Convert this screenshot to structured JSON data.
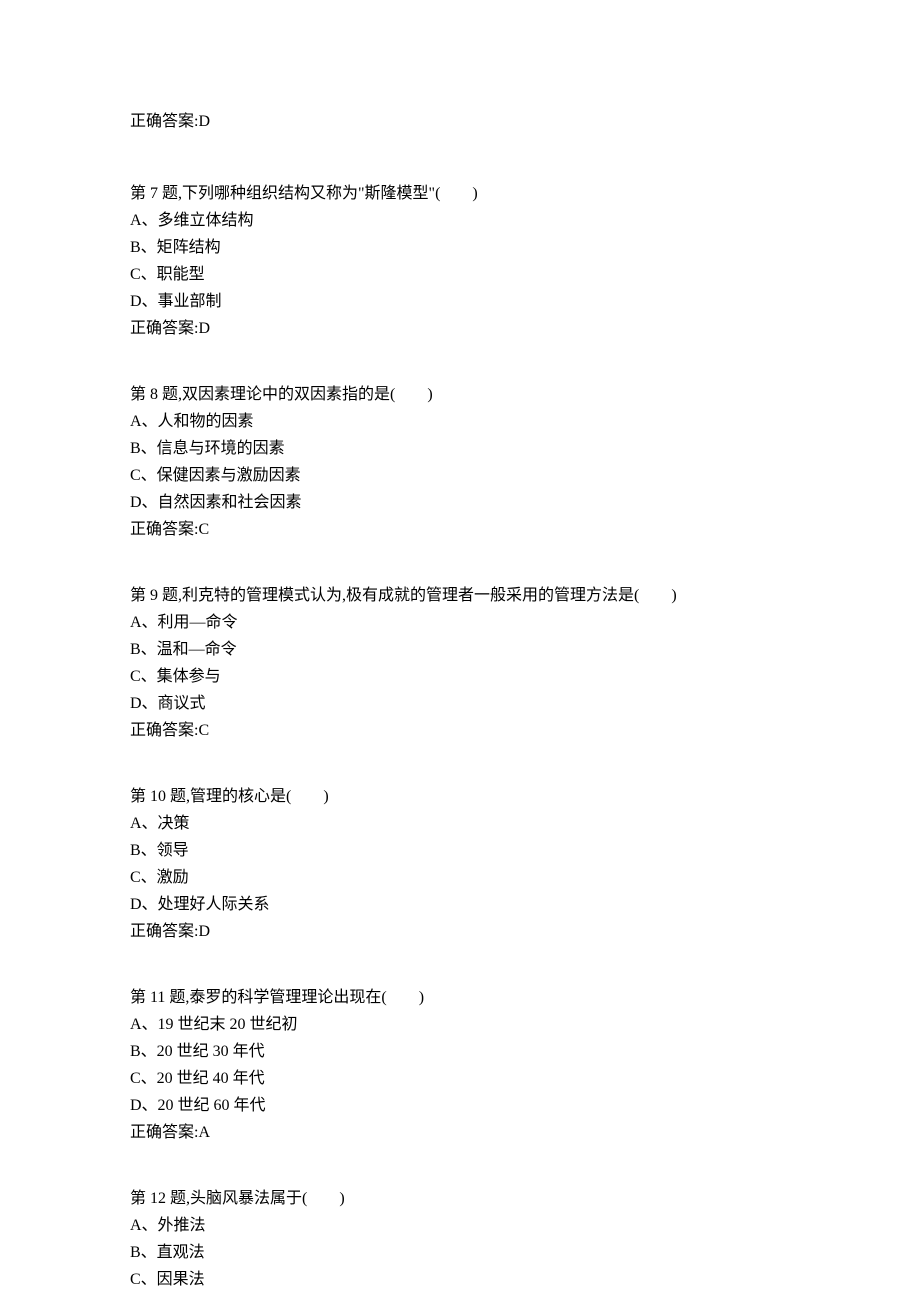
{
  "prev_answer": "正确答案:D",
  "questions": [
    {
      "title": "第 7 题,下列哪种组织结构又称为\"斯隆模型\"(　　)",
      "options": [
        "A、多维立体结构",
        "B、矩阵结构",
        "C、职能型",
        "D、事业部制"
      ],
      "answer": "正确答案:D"
    },
    {
      "title": "第 8 题,双因素理论中的双因素指的是(　　)",
      "options": [
        "A、人和物的因素",
        "B、信息与环境的因素",
        "C、保健因素与激励因素",
        "D、自然因素和社会因素"
      ],
      "answer": "正确答案:C"
    },
    {
      "title": "第 9 题,利克特的管理模式认为,极有成就的管理者一般采用的管理方法是(　　)",
      "options": [
        "A、利用—命令",
        "B、温和—命令",
        "C、集体参与",
        "D、商议式"
      ],
      "answer": "正确答案:C"
    },
    {
      "title": "第 10 题,管理的核心是(　　)",
      "options": [
        "A、决策",
        "B、领导",
        "C、激励",
        "D、处理好人际关系"
      ],
      "answer": "正确答案:D"
    },
    {
      "title": "第 11 题,泰罗的科学管理理论出现在(　　)",
      "options": [
        "A、19 世纪末 20 世纪初",
        "B、20 世纪 30 年代",
        "C、20 世纪 40 年代",
        "D、20 世纪 60 年代"
      ],
      "answer": "正确答案:A"
    },
    {
      "title": "第 12 题,头脑风暴法属于(　　)",
      "options": [
        "A、外推法",
        "B、直观法",
        "C、因果法"
      ],
      "answer": ""
    }
  ]
}
